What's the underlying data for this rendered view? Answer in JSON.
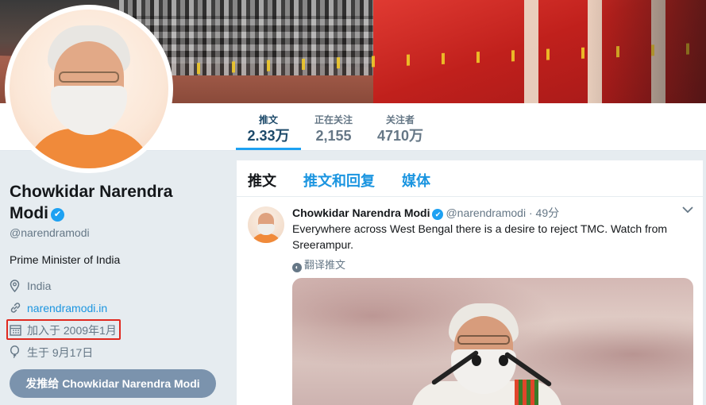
{
  "nav": {
    "stats": [
      {
        "label": "推文",
        "value": "2.33万"
      },
      {
        "label": "正在关注",
        "value": "2,155"
      },
      {
        "label": "关注者",
        "value": "4710万"
      }
    ]
  },
  "profile": {
    "name_line1": "Chowkidar Narendra",
    "name_line2": "Modi",
    "verified_glyph": "✔",
    "handle": "@narendramodi",
    "bio": "Prime Minister of India",
    "location": "India",
    "website": "narendramodi.in",
    "joined": "加入于 2009年1月",
    "birthday": "生于 9月17日",
    "tweet_to_button": "发推给 Chowkidar Narendra Modi",
    "icons": {
      "location": "location-pin-icon",
      "website": "link-icon",
      "joined": "calendar-icon",
      "birthday": "balloon-icon"
    }
  },
  "timeline": {
    "tabs": [
      "推文",
      "推文和回复",
      "媒体"
    ],
    "tweet": {
      "name": "Chowkidar Narendra Modi",
      "handle": "@narendramodi",
      "dot": "·",
      "time": "49分",
      "text": "Everywhere across West Bengal there is a desire to reject TMC. Watch from Sreerampur.",
      "translate": "翻译推文"
    }
  },
  "colors": {
    "accent": "#1da1f2",
    "link": "#1b95e0",
    "highlight": "#e0291f",
    "button": "#7b93ad"
  }
}
